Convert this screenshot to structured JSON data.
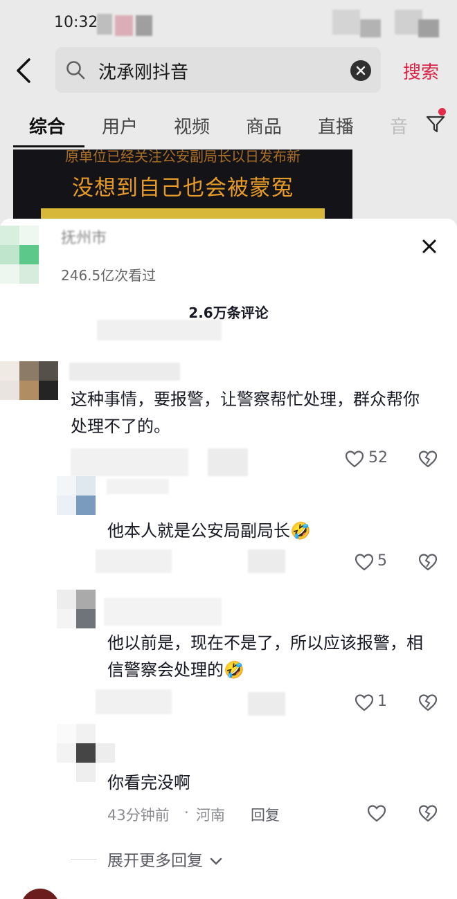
{
  "status_bar": {
    "time": "10:32"
  },
  "search": {
    "query": "沈承刚抖音",
    "submit_label": "搜索"
  },
  "tabs": [
    {
      "label": "综合",
      "active": true
    },
    {
      "label": "用户",
      "active": false
    },
    {
      "label": "视频",
      "active": false
    },
    {
      "label": "商品",
      "active": false
    },
    {
      "label": "直播",
      "active": false
    },
    {
      "label": "音",
      "active": false
    }
  ],
  "video_thumbnail": {
    "top_text": "原单位已经关注公安副局长以日发布新",
    "headline": "没想到自己也会被蒙冤"
  },
  "sheet_header": {
    "author_name": "抚州市",
    "views": "246.5亿次看过",
    "comment_count": "2.6万条评论"
  },
  "comments": [
    {
      "text": "这种事情，要报警，让警察帮忙处理，群众帮你处理不了的。",
      "likes": "52"
    },
    {
      "text": "他本人就是公安局副局长🤣",
      "likes": "5"
    },
    {
      "text": "他以前是，现在不是了，所以应该报警，相信警察会处理的🤣",
      "likes": "1"
    },
    {
      "text": "你看完没啊",
      "time": "43分钟前",
      "location": "河南",
      "reply_label": "回复"
    }
  ],
  "expand_more": "展开更多回复",
  "colors": {
    "accent": "#e3284b",
    "text": "#161823",
    "meta": "#8a8b91"
  }
}
